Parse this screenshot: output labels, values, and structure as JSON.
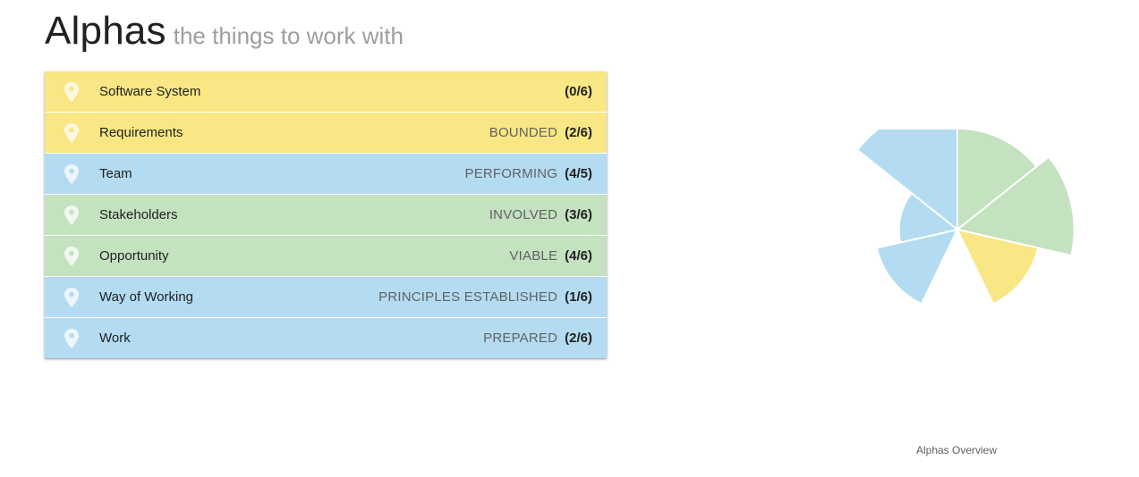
{
  "header": {
    "title": "Alphas",
    "subtitle": "the things to work with"
  },
  "alphas": [
    {
      "name": "Software System",
      "state": "",
      "progress": "(0/6)",
      "color": "#f8e784",
      "completed": 0,
      "total": 6
    },
    {
      "name": "Requirements",
      "state": "BOUNDED",
      "progress": "(2/6)",
      "color": "#f8e784",
      "completed": 2,
      "total": 6
    },
    {
      "name": "Team",
      "state": "PERFORMING",
      "progress": "(4/5)",
      "color": "#b3dcf2",
      "completed": 4,
      "total": 5
    },
    {
      "name": "Stakeholders",
      "state": "INVOLVED",
      "progress": "(3/6)",
      "color": "#c4e2c0",
      "completed": 3,
      "total": 6
    },
    {
      "name": "Opportunity",
      "state": "VIABLE",
      "progress": "(4/6)",
      "color": "#c4e2c0",
      "completed": 4,
      "total": 6
    },
    {
      "name": "Way of Working",
      "state": "PRINCIPLES ESTABLISHED",
      "progress": "(1/6)",
      "color": "#b3dcf2",
      "completed": 1,
      "total": 6
    },
    {
      "name": "Work",
      "state": "PREPARED",
      "progress": "(2/6)",
      "color": "#b3dcf2",
      "completed": 2,
      "total": 6
    }
  ],
  "chart": {
    "caption": "Alphas Overview"
  },
  "colors": {
    "customer": "#c4e2c0",
    "solution": "#f8e784",
    "endeavor": "#b3dcf2",
    "pin": "rgba(255,255,255,0.75)"
  },
  "icons": {
    "pin": "map-marker-icon"
  },
  "chart_data": {
    "type": "polar-area",
    "categories": [
      "Stakeholders",
      "Opportunity",
      "Requirements",
      "Software System",
      "Work",
      "Way of Working",
      "Team"
    ],
    "values": [
      0.5,
      0.6667,
      0.3333,
      0,
      0.3333,
      0.1667,
      0.8
    ],
    "colors": [
      "#c4e2c0",
      "#c4e2c0",
      "#f8e784",
      "#f8e784",
      "#b3dcf2",
      "#b3dcf2",
      "#b3dcf2"
    ],
    "rmax": 1,
    "title": ""
  }
}
